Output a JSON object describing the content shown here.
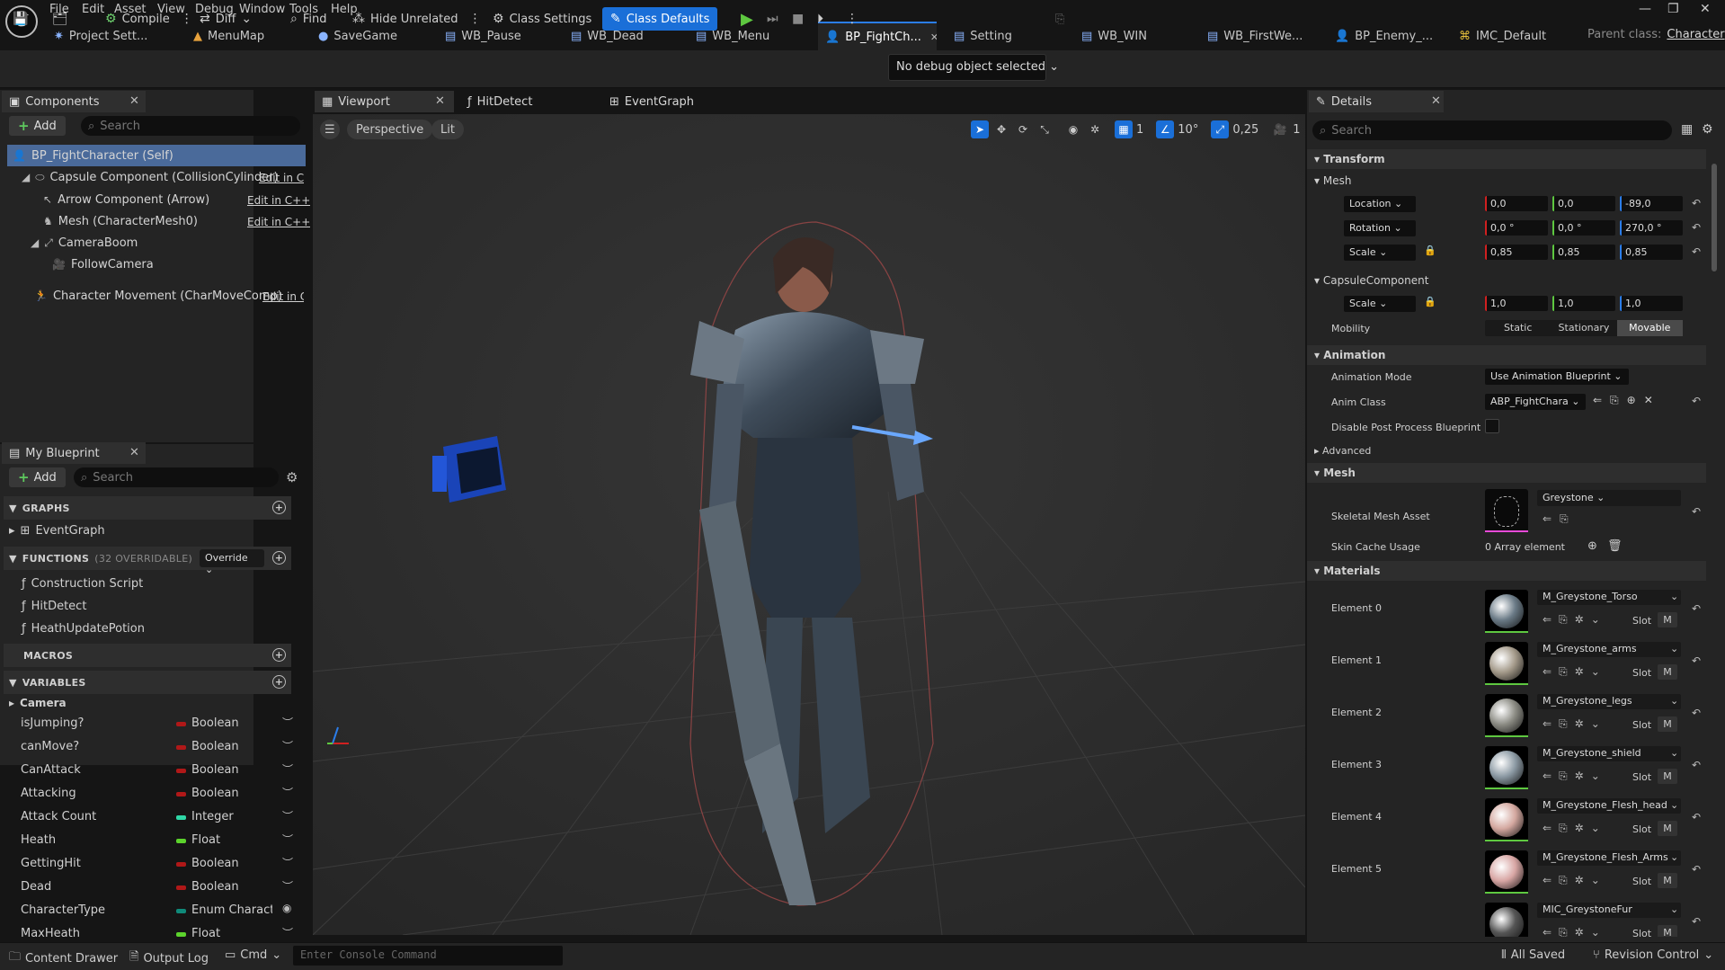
{
  "menu": [
    "File",
    "Edit",
    "Asset",
    "View",
    "Debug",
    "Window",
    "Tools",
    "Help"
  ],
  "logo": "U",
  "tabs": [
    {
      "label": "Project Sett...",
      "icon": "✷"
    },
    {
      "label": "MenuMap",
      "icon": "▲"
    },
    {
      "label": "SaveGame",
      "icon": "●"
    },
    {
      "label": "WB_Pause",
      "icon": "▤"
    },
    {
      "label": "WB_Dead",
      "icon": "▤"
    },
    {
      "label": "WB_Menu",
      "icon": "▤"
    },
    {
      "label": "BP_FightCh...",
      "icon": "👤"
    },
    {
      "label": "Setting",
      "icon": "▤"
    },
    {
      "label": "WB_WIN",
      "icon": "▤"
    },
    {
      "label": "WB_FirstWe...",
      "icon": "▤"
    },
    {
      "label": "BP_Enemy_...",
      "icon": "👤"
    },
    {
      "label": "IMC_Default",
      "icon": "⌘"
    }
  ],
  "parent_class": {
    "label": "Parent class:",
    "value": "Character"
  },
  "toolbar": {
    "compile": "Compile",
    "diff": "Diff",
    "find": "Find",
    "hide_unrelated": "Hide Unrelated",
    "class_settings": "Class Settings",
    "class_defaults": "Class Defaults",
    "debug_object": "No debug object selected"
  },
  "components": {
    "tab": "Components",
    "add": "Add",
    "search_placeholder": "Search",
    "self": "BP_FightCharacter (Self)",
    "items": [
      {
        "label": "Capsule Component (CollisionCylinder)",
        "edit": "Edit in C+"
      },
      {
        "label": "Arrow Component (Arrow)",
        "edit": "Edit in C++"
      },
      {
        "label": "Mesh (CharacterMesh0)",
        "edit": "Edit in C++"
      },
      {
        "label": "CameraBoom",
        "edit": ""
      },
      {
        "label": "FollowCamera",
        "edit": ""
      },
      {
        "label": "Character Movement (CharMoveComp)",
        "edit": "Edit in C"
      }
    ]
  },
  "my_blueprint": {
    "tab": "My Blueprint",
    "add": "Add",
    "search_placeholder": "Search",
    "graphs_header": "GRAPHS",
    "graphs": [
      "EventGraph"
    ],
    "functions_header": "FUNCTIONS",
    "functions_count": "(32 OVERRIDABLE)",
    "override": "Override",
    "functions": [
      "Construction Script",
      "HitDetect",
      "HeathUpdatePotion"
    ],
    "macros_header": "MACROS",
    "variables_header": "VARIABLES",
    "camera_category": "Camera",
    "variables": [
      {
        "name": "isJumping?",
        "type": "Boolean",
        "color": "#b01818"
      },
      {
        "name": "canMove?",
        "type": "Boolean",
        "color": "#b01818"
      },
      {
        "name": "CanAttack",
        "type": "Boolean",
        "color": "#b01818"
      },
      {
        "name": "Attacking",
        "type": "Boolean",
        "color": "#b01818"
      },
      {
        "name": "Attack Count",
        "type": "Integer",
        "color": "#2fd7a6"
      },
      {
        "name": "Heath",
        "type": "Float",
        "color": "#5cd32c"
      },
      {
        "name": "GettingHit",
        "type": "Boolean",
        "color": "#b01818"
      },
      {
        "name": "Dead",
        "type": "Boolean",
        "color": "#b01818"
      },
      {
        "name": "CharacterType",
        "type": "Enum Characte",
        "color": "#0f8a7a"
      },
      {
        "name": "MaxHeath",
        "type": "Float",
        "color": "#5cd32c"
      }
    ]
  },
  "editor_tabs": {
    "viewport": "Viewport",
    "hitdetect": "HitDetect",
    "eventgraph": "EventGraph"
  },
  "viewport": {
    "perspective": "Perspective",
    "lit": "Lit",
    "grid_snap": "1",
    "rot_snap": "10°",
    "scale_snap": "0,25",
    "cam_speed": "1"
  },
  "details": {
    "tab": "Details",
    "search_placeholder": "Search",
    "transform": "Transform",
    "mesh_sub": "Mesh",
    "location": {
      "label": "Location",
      "x": "0,0",
      "y": "0,0",
      "z": "-89,0"
    },
    "rotation": {
      "label": "Rotation",
      "x": "0,0 °",
      "y": "0,0 °",
      "z": "270,0 °"
    },
    "scale": {
      "label": "Scale",
      "x": "0,85",
      "y": "0,85",
      "z": "0,85"
    },
    "capsule_sub": "CapsuleComponent",
    "capsule_scale": {
      "label": "Scale",
      "x": "1,0",
      "y": "1,0",
      "z": "1,0"
    },
    "mobility": {
      "label": "Mobility",
      "options": [
        "Static",
        "Stationary",
        "Movable"
      ]
    },
    "animation": "Animation",
    "anim_mode": {
      "label": "Animation Mode",
      "value": "Use Animation Blueprint"
    },
    "anim_class": {
      "label": "Anim Class",
      "value": "ABP_FightChara"
    },
    "disable_pp": "Disable Post Process Blueprint",
    "advanced": "Advanced",
    "mesh": "Mesh",
    "skel_mesh": {
      "label": "Skeletal Mesh Asset",
      "value": "Greystone"
    },
    "skin_cache": {
      "label": "Skin Cache Usage",
      "value": "0 Array element"
    },
    "materials": "Materials",
    "elements": [
      {
        "label": "Element 0",
        "value": "M_Greystone_Torso",
        "color": "#6a7a86"
      },
      {
        "label": "Element 1",
        "value": "M_Greystone_arms",
        "color": "#a49a8a"
      },
      {
        "label": "Element 2",
        "value": "M_Greystone_legs",
        "color": "#8c8c84"
      },
      {
        "label": "Element 3",
        "value": "M_Greystone_shield",
        "color": "#8c9aa4"
      },
      {
        "label": "Element 4",
        "value": "M_Greystone_Flesh_head",
        "color": "#d4a8a0"
      },
      {
        "label": "Element 5",
        "value": "M_Greystone_Flesh_Arms",
        "color": "#d8a6a4"
      },
      {
        "label": "",
        "value": "MIC_GreystoneFur",
        "color": "#555"
      }
    ],
    "slot": "Slot",
    "m": "M"
  },
  "status": {
    "content_drawer": "Content Drawer",
    "output_log": "Output Log",
    "cmd": "Cmd",
    "console_placeholder": "Enter Console Command",
    "all_saved": "All Saved",
    "revision": "Revision Control"
  }
}
